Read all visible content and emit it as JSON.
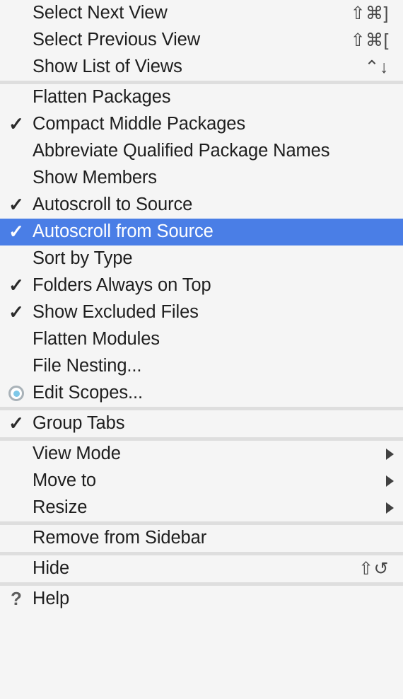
{
  "menu": {
    "type": "context-menu",
    "background_color": "#f5f5f5",
    "selection_color": "#4a7ee6",
    "separator_color": "#dedede",
    "text_color": "#1e1e1e",
    "sections": [
      {
        "name": "views-navigation",
        "items": [
          {
            "label": "Select Next View",
            "shortcut": "⇧⌘]",
            "checked": false,
            "submenu": false,
            "selected": false,
            "icon": ""
          },
          {
            "label": "Select Previous View",
            "shortcut": "⇧⌘[",
            "checked": false,
            "submenu": false,
            "selected": false,
            "icon": ""
          },
          {
            "label": "Show List of Views",
            "shortcut": "⌃↓",
            "checked": false,
            "submenu": false,
            "selected": false,
            "icon": ""
          }
        ]
      },
      {
        "name": "project-view-options",
        "items": [
          {
            "label": "Flatten Packages",
            "shortcut": "",
            "checked": false,
            "submenu": false,
            "selected": false,
            "icon": ""
          },
          {
            "label": "Compact Middle Packages",
            "shortcut": "",
            "checked": true,
            "submenu": false,
            "selected": false,
            "icon": "check-icon"
          },
          {
            "label": "Abbreviate Qualified Package Names",
            "shortcut": "",
            "checked": false,
            "submenu": false,
            "selected": false,
            "icon": ""
          },
          {
            "label": "Show Members",
            "shortcut": "",
            "checked": false,
            "submenu": false,
            "selected": false,
            "icon": ""
          },
          {
            "label": "Autoscroll to Source",
            "shortcut": "",
            "checked": true,
            "submenu": false,
            "selected": false,
            "icon": "check-icon"
          },
          {
            "label": "Autoscroll from Source",
            "shortcut": "",
            "checked": true,
            "submenu": false,
            "selected": true,
            "icon": "check-icon"
          },
          {
            "label": "Sort by Type",
            "shortcut": "",
            "checked": false,
            "submenu": false,
            "selected": false,
            "icon": ""
          },
          {
            "label": "Folders Always on Top",
            "shortcut": "",
            "checked": true,
            "submenu": false,
            "selected": false,
            "icon": "check-icon"
          },
          {
            "label": "Show Excluded Files",
            "shortcut": "",
            "checked": true,
            "submenu": false,
            "selected": false,
            "icon": "check-icon"
          },
          {
            "label": "Flatten Modules",
            "shortcut": "",
            "checked": false,
            "submenu": false,
            "selected": false,
            "icon": ""
          },
          {
            "label": "File Nesting...",
            "shortcut": "",
            "checked": false,
            "submenu": false,
            "selected": false,
            "icon": ""
          },
          {
            "label": "Edit Scopes...",
            "shortcut": "",
            "checked": false,
            "submenu": false,
            "selected": false,
            "icon": "scope-radio-icon"
          }
        ]
      },
      {
        "name": "tabs-options",
        "items": [
          {
            "label": "Group Tabs",
            "shortcut": "",
            "checked": true,
            "submenu": false,
            "selected": false,
            "icon": "check-icon"
          }
        ]
      },
      {
        "name": "window-options",
        "items": [
          {
            "label": "View Mode",
            "shortcut": "",
            "checked": false,
            "submenu": true,
            "selected": false,
            "icon": ""
          },
          {
            "label": "Move to",
            "shortcut": "",
            "checked": false,
            "submenu": true,
            "selected": false,
            "icon": ""
          },
          {
            "label": "Resize",
            "shortcut": "",
            "checked": false,
            "submenu": true,
            "selected": false,
            "icon": ""
          }
        ]
      },
      {
        "name": "sidebar-options",
        "items": [
          {
            "label": "Remove from Sidebar",
            "shortcut": "",
            "checked": false,
            "submenu": false,
            "selected": false,
            "icon": ""
          }
        ]
      },
      {
        "name": "hide-options",
        "items": [
          {
            "label": "Hide",
            "shortcut": "⇧↺",
            "checked": false,
            "submenu": false,
            "selected": false,
            "icon": ""
          }
        ]
      },
      {
        "name": "help-options",
        "items": [
          {
            "label": "Help",
            "shortcut": "",
            "checked": false,
            "submenu": false,
            "selected": false,
            "icon": "question-mark-icon"
          }
        ]
      }
    ]
  }
}
